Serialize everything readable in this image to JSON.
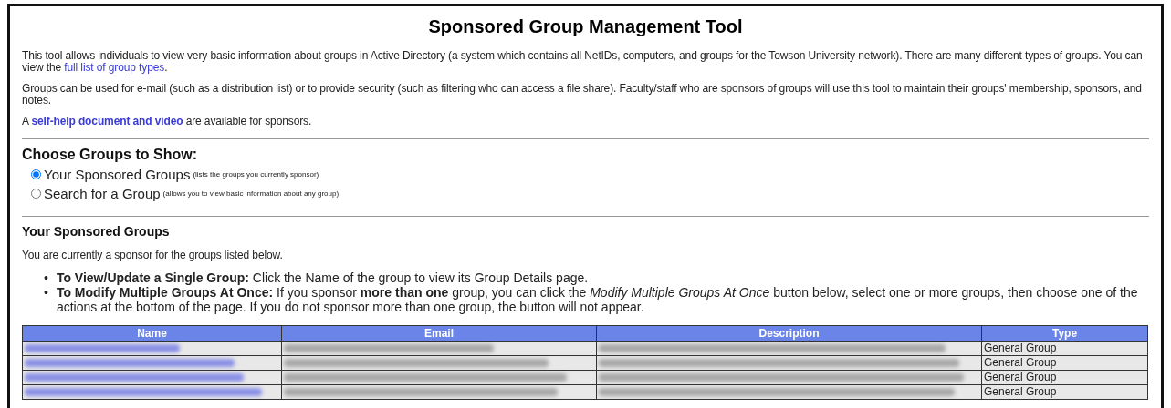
{
  "title": "Sponsored Group Management Tool",
  "intro": [
    {
      "before": "This tool allows individuals to view very basic information about groups in Active Directory (a system which contains all NetIDs, computers, and groups for the Towson University network). There are many different types of groups. You can view the ",
      "link": "full list of group types",
      "after": ".",
      "link_bold": false
    },
    {
      "before": "Groups can be used for e-mail (such as a distribution list) or to provide security (such as filtering who can access a file share). Faculty/staff who are sponsors of groups will use this tool to maintain their groups' membership, sponsors, and notes."
    },
    {
      "before": "A ",
      "link": "self-help document and video",
      "after": " are available for sponsors.",
      "link_bold": true
    }
  ],
  "choose": {
    "heading": "Choose Groups to Show:",
    "options": [
      {
        "label": "Your Sponsored Groups",
        "hint": "(lists the groups you currently sponsor)",
        "selected": true
      },
      {
        "label": "Search for a Group",
        "hint": "(allows you to view basic information about any group)",
        "selected": false
      }
    ]
  },
  "sponsored": {
    "heading": "Your Sponsored Groups",
    "text": "You are currently a sponsor for the groups listed below.",
    "bullets": [
      {
        "marker": "•",
        "lead": "To View/Update a Single Group:",
        "text": "Click the Name of the group to view its Group Details page."
      },
      {
        "marker": "•",
        "lead": "To Modify Multiple Groups At Once:",
        "text": "If you sponsor **more than one** group, you can click the *Modify Multiple Groups At Once* button below, select one or more groups, then choose one of the actions at the bottom of the page. If you do not sponsor more than one group, the button will not appear."
      }
    ]
  },
  "table": {
    "columns": [
      "Name",
      "Email",
      "Description",
      "Type"
    ],
    "rows": [
      {
        "type": "General Group"
      },
      {
        "type": "General Group"
      },
      {
        "type": "General Group"
      },
      {
        "type": "General Group"
      }
    ]
  }
}
